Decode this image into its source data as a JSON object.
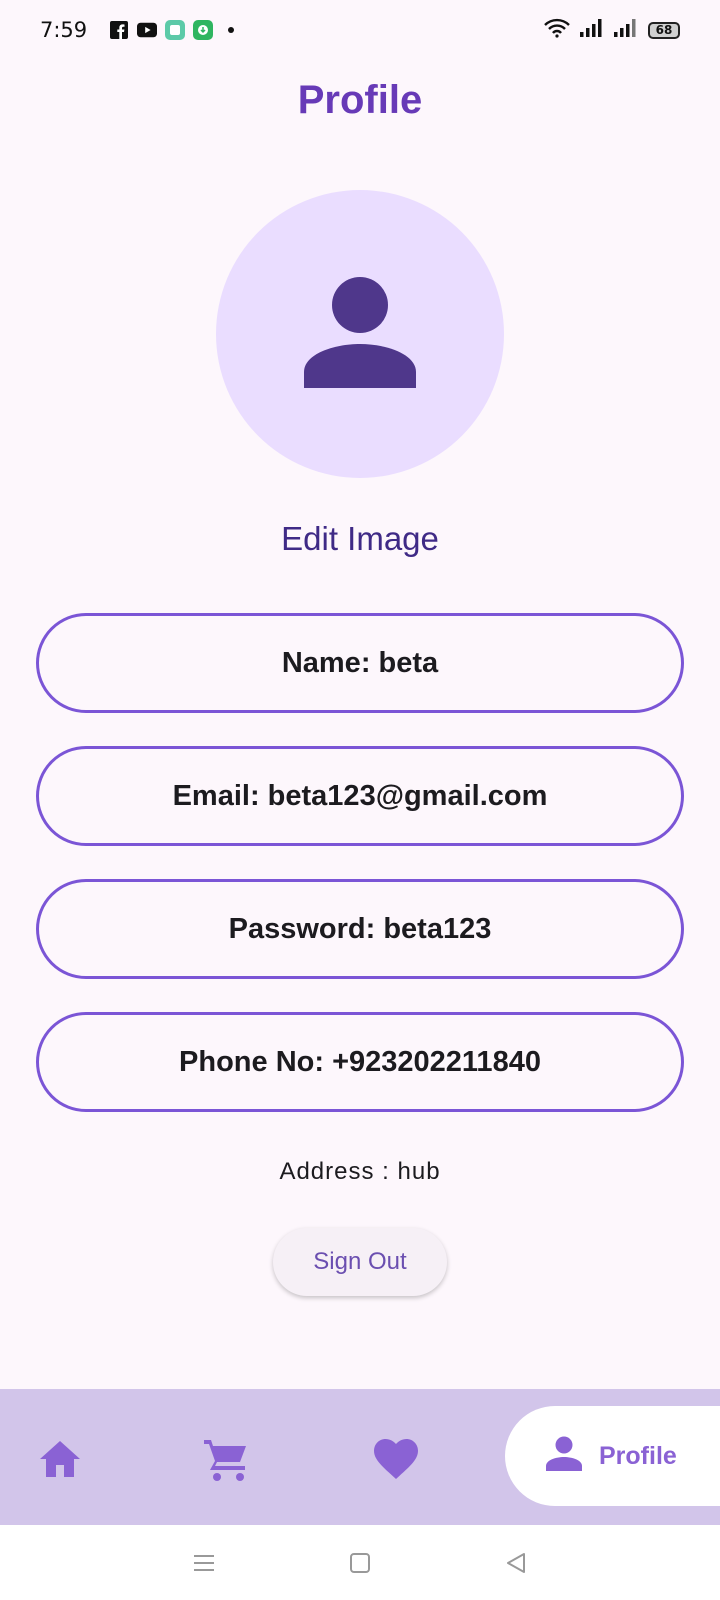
{
  "status_bar": {
    "time": "7:59",
    "battery": "68",
    "icons": [
      "facebook-icon",
      "youtube-icon",
      "app-icon",
      "download-app-icon",
      "notification-dot-icon",
      "wifi-icon",
      "signal-icon",
      "signal-icon"
    ]
  },
  "header": {
    "title": "Profile"
  },
  "avatar": {
    "icon": "person-icon"
  },
  "edit_image_label": "Edit Image",
  "fields": {
    "name": "Name: beta",
    "email": "Email: beta123@gmail.com",
    "password": "Password: beta123",
    "phone": "Phone No: +923202211840"
  },
  "address": "Address : hub",
  "signout_label": "Sign Out",
  "bottom_nav": {
    "items": [
      {
        "icon": "home-icon"
      },
      {
        "icon": "cart-icon"
      },
      {
        "icon": "heart-icon"
      },
      {
        "icon": "person-icon",
        "label": "Profile",
        "active": true
      }
    ]
  },
  "colors": {
    "accent": "#673ab7",
    "field_border": "#7b55d6",
    "avatar_bg": "#eaddff",
    "nav_bg": "#d2c5ea",
    "nav_icon": "#8a62d4",
    "background": "#fdf7fc"
  }
}
